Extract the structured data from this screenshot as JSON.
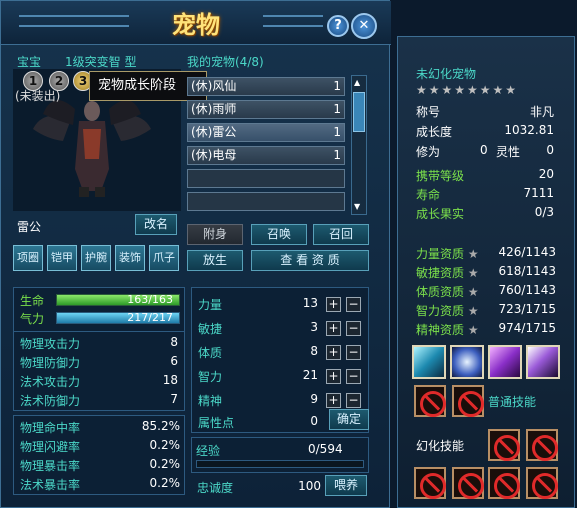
{
  "window": {
    "title": "宠物",
    "help_label": "?"
  },
  "tabs": {
    "baobao": "宝宝",
    "type": "1级突变智",
    "type2": "型",
    "my_pets": "我的宠物(4/8)"
  },
  "stage_circles": [
    "1",
    "2",
    "3"
  ],
  "tooltip": "宠物成长阶段",
  "tag": "(未装出)",
  "pets": [
    {
      "name": "(休)风仙",
      "count": "1"
    },
    {
      "name": "(休)雨师",
      "count": "1"
    },
    {
      "name": "(休)雷公",
      "count": "1"
    },
    {
      "name": "(休)电母",
      "count": "1"
    }
  ],
  "pet_name": "雷公",
  "buttons": {
    "rename": "改名",
    "attach": "附身",
    "summon": "召唤",
    "recall": "召回",
    "release": "放生",
    "view": "查 看 资 质",
    "confirm": "确定",
    "feed": "喂养"
  },
  "equip": [
    "项圈",
    "铠甲",
    "护腕",
    "装饰",
    "爪子"
  ],
  "bars": {
    "hp_label": "生命",
    "hp": "163/163",
    "hp_fill": 1.0,
    "mp_label": "气力",
    "mp": "217/217",
    "mp_fill": 1.0
  },
  "combat": [
    {
      "label": "物理攻击力",
      "value": "8"
    },
    {
      "label": "物理防御力",
      "value": "6"
    },
    {
      "label": "法术攻击力",
      "value": "18"
    },
    {
      "label": "法术防御力",
      "value": "7"
    }
  ],
  "rates": [
    {
      "label": "物理命中率",
      "value": "85.2%"
    },
    {
      "label": "物理闪避率",
      "value": "0.2%"
    },
    {
      "label": "物理暴击率",
      "value": "0.2%"
    },
    {
      "label": "法术暴击率",
      "value": "0.2%"
    }
  ],
  "attrs": [
    {
      "label": "力量",
      "value": "13"
    },
    {
      "label": "敏捷",
      "value": "3"
    },
    {
      "label": "体质",
      "value": "8"
    },
    {
      "label": "智力",
      "value": "21"
    },
    {
      "label": "精神",
      "value": "9"
    }
  ],
  "points": {
    "label": "属性点",
    "value": "0"
  },
  "exp": {
    "label": "经验",
    "value": "0/594",
    "fill": 0
  },
  "loyalty": {
    "label": "忠诚度",
    "value": "100"
  },
  "side": {
    "title": "未幻化宠物",
    "stars": "★★★★★★★★",
    "rows": [
      {
        "k": "称号",
        "v": "非凡"
      },
      {
        "k": "成长度",
        "v": "1032.81"
      }
    ],
    "xiuwei": {
      "k": "修为",
      "v": "0",
      "k2": "灵性",
      "v2": "0"
    },
    "green": [
      {
        "k": "携带等级",
        "v": "20"
      },
      {
        "k": "寿命",
        "v": "7111"
      },
      {
        "k": "成长果实",
        "v": "0/3"
      }
    ],
    "apt": [
      {
        "k": "力量资质",
        "v": "426/1143"
      },
      {
        "k": "敏捷资质",
        "v": "618/1143"
      },
      {
        "k": "体质资质",
        "v": "760/1143"
      },
      {
        "k": "智力资质",
        "v": "723/1715"
      },
      {
        "k": "精神资质",
        "v": "974/1715"
      }
    ],
    "normal_skill": "普通技能",
    "huanhua_skill": "幻化技能"
  }
}
